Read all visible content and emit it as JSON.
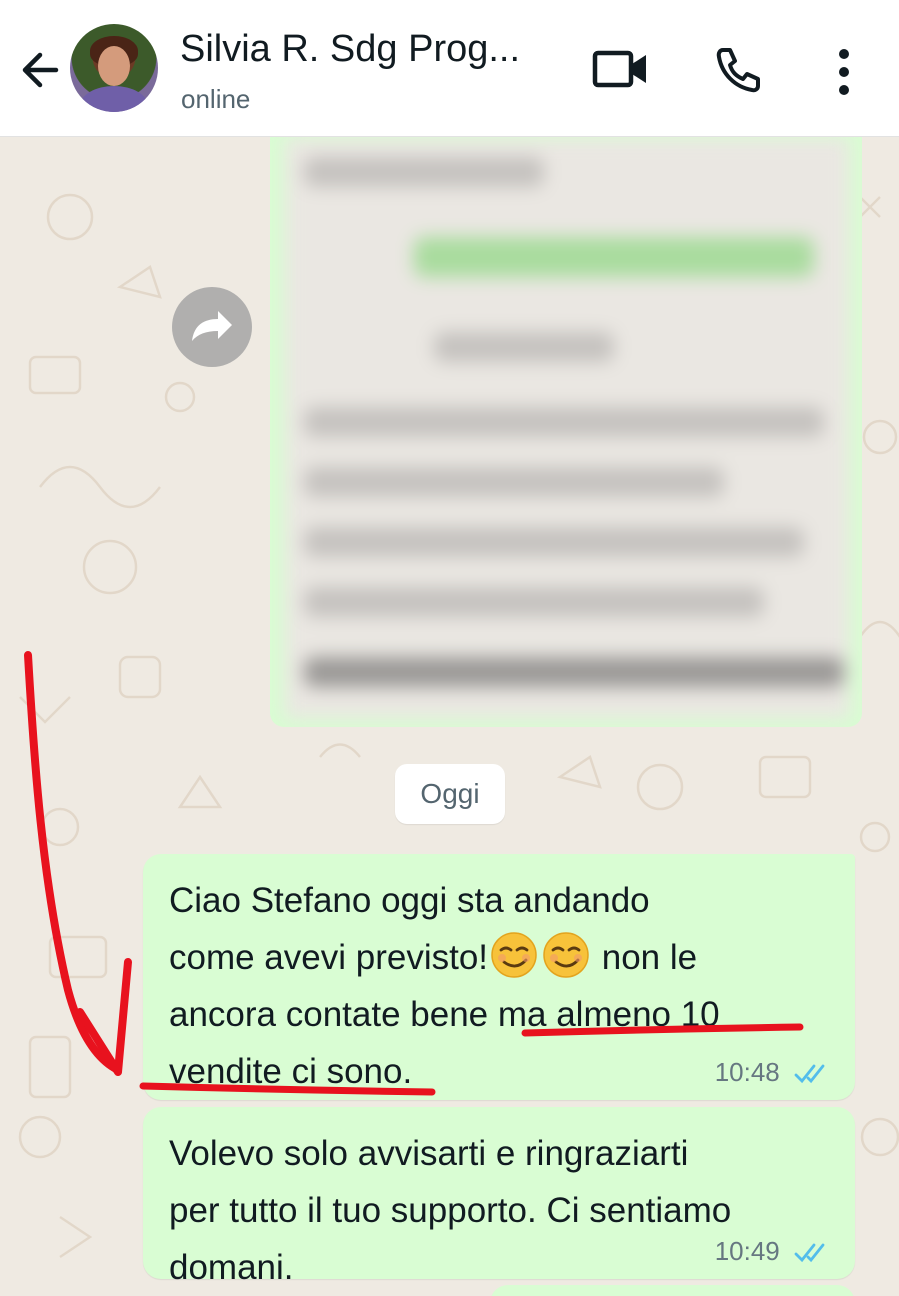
{
  "header": {
    "contact_name": "Silvia R. Sdg Prog...",
    "status": "online",
    "icons": [
      "back-arrow-icon",
      "avatar",
      "video-call-icon",
      "phone-icon",
      "more-vertical-icon"
    ]
  },
  "chat": {
    "forwarded_image": {
      "state": "blurred",
      "icon": "forward-icon"
    },
    "date_separator": "Oggi",
    "messages": [
      {
        "direction": "outgoing",
        "lines": [
          {
            "text": "Ciao Stefano oggi sta andando"
          },
          {
            "before": "come avevi previsto!",
            "emojis": [
              "wink-smile-emoji",
              "wink-smile-emoji"
            ],
            "after": " non le"
          },
          {
            "text": "ancora contate bene ma almeno 10"
          },
          {
            "text": "vendite ci sono."
          }
        ],
        "time": "10:48",
        "status": "read"
      },
      {
        "direction": "outgoing",
        "lines": [
          {
            "text": "Volevo solo avvisarti e ringraziarti"
          },
          {
            "text": "per tutto il tuo supporto. Ci sentiamo"
          },
          {
            "text": "domani."
          }
        ],
        "time": "10:49",
        "status": "read"
      }
    ]
  },
  "colors": {
    "outgoing_bubble": "#d9fdd3",
    "chat_background": "#efeae2",
    "read_ticks": "#53bdeb",
    "annotation": "#e8121e"
  }
}
